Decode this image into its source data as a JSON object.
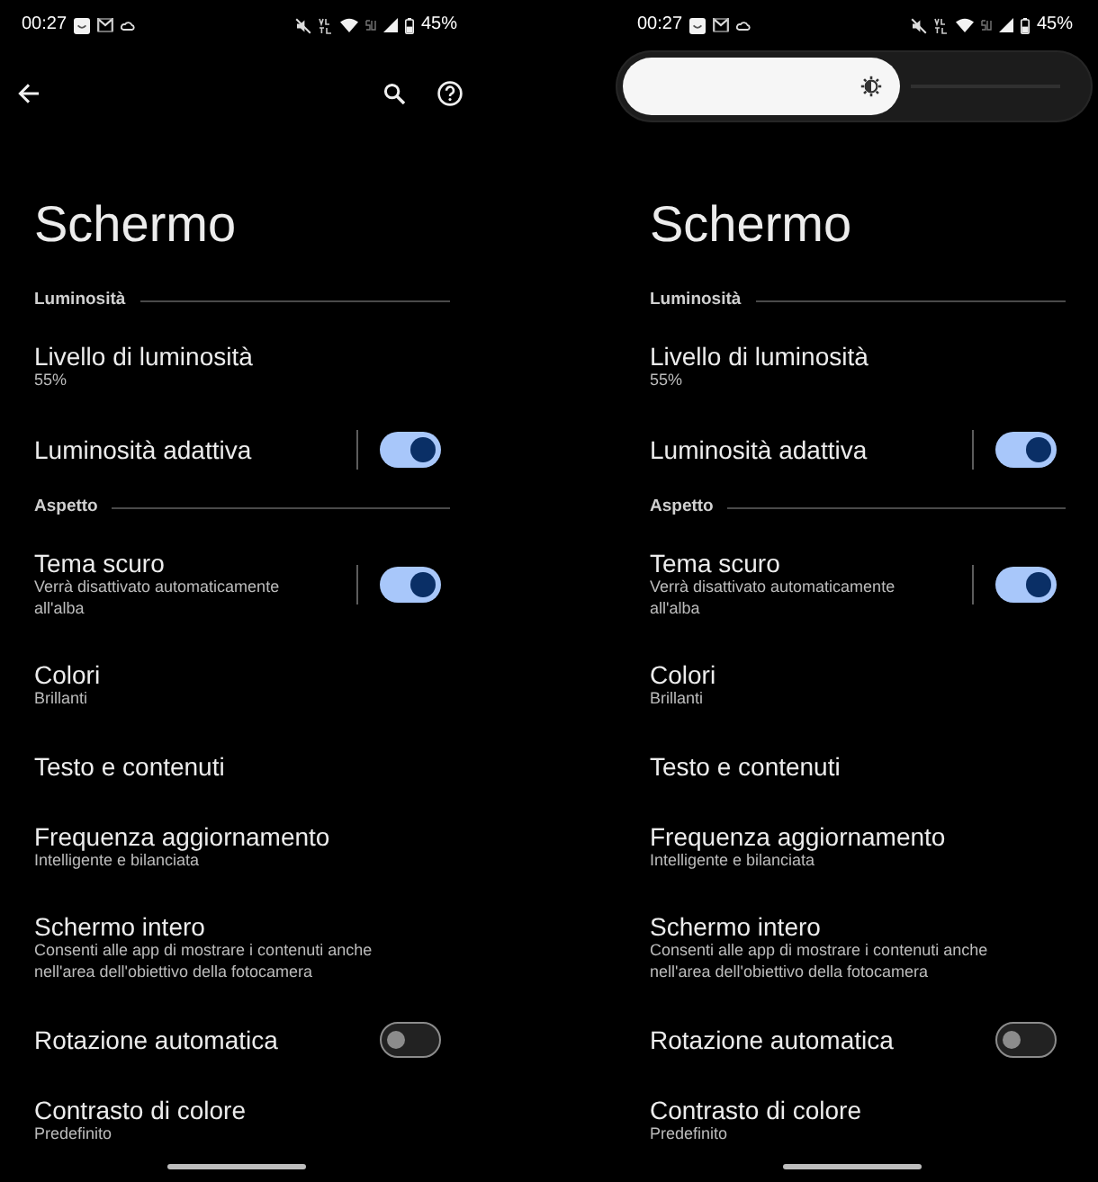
{
  "screens": [
    {
      "status_bar": {
        "time": "00:27",
        "battery": "45%"
      },
      "top": {
        "kind": "toolbar"
      },
      "title": "Schermo",
      "items": [
        {
          "kind": "header",
          "label": "Luminosità"
        },
        {
          "kind": "item",
          "title": "Livello di luminosità",
          "summary": "55%"
        },
        {
          "kind": "split_switch",
          "title": "Luminosità adattiva",
          "on": true
        },
        {
          "kind": "header",
          "label": "Aspetto"
        },
        {
          "kind": "split_switch",
          "title": "Tema scuro",
          "summary": "Verrà disattivato automaticamente all'alba",
          "on": true
        },
        {
          "kind": "item",
          "title": "Colori",
          "summary": "Brillanti"
        },
        {
          "kind": "item",
          "title": "Testo e contenuti"
        },
        {
          "kind": "item",
          "title": "Frequenza aggiornamento",
          "summary": "Intelligente e bilanciata"
        },
        {
          "kind": "item",
          "title": "Schermo intero",
          "summary": "Consenti alle app di mostrare i contenuti anche nell'area dell'obiettivo della fotocamera"
        },
        {
          "kind": "switch",
          "title": "Rotazione automatica",
          "on": false
        },
        {
          "kind": "item",
          "title": "Contrasto di colore",
          "summary": "Predefinito"
        }
      ]
    },
    {
      "status_bar": {
        "time": "00:27",
        "battery": "45%"
      },
      "top": {
        "kind": "brightness_slider",
        "level": 0.6
      },
      "title": "Schermo",
      "items": [
        {
          "kind": "header",
          "label": "Luminosità"
        },
        {
          "kind": "item",
          "title": "Livello di luminosità",
          "summary": "55%"
        },
        {
          "kind": "split_switch",
          "title": "Luminosità adattiva",
          "on": true
        },
        {
          "kind": "header",
          "label": "Aspetto"
        },
        {
          "kind": "split_switch",
          "title": "Tema scuro",
          "summary": "Verrà disattivato automaticamente all'alba",
          "on": true
        },
        {
          "kind": "item",
          "title": "Colori",
          "summary": "Brillanti"
        },
        {
          "kind": "item",
          "title": "Testo e contenuti"
        },
        {
          "kind": "item",
          "title": "Frequenza aggiornamento",
          "summary": "Intelligente e bilanciata"
        },
        {
          "kind": "item",
          "title": "Schermo intero",
          "summary": "Consenti alle app di mostrare i contenuti anche nell'area dell'obiettivo della fotocamera"
        },
        {
          "kind": "switch",
          "title": "Rotazione automatica",
          "on": false
        },
        {
          "kind": "item",
          "title": "Contrasto di colore",
          "summary": "Predefinito"
        }
      ]
    }
  ]
}
